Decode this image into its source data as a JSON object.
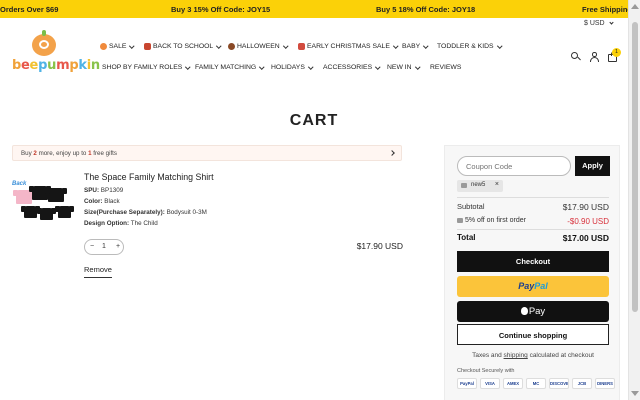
{
  "announcements": [
    {
      "text": "Orders Over $69"
    },
    {
      "text": "Buy 3 15% Off Code: JOY15"
    },
    {
      "text": "Buy 5 18% Off Code: JOY18"
    },
    {
      "text": "Free Shipping On"
    }
  ],
  "header": {
    "currency": "$ USD",
    "logo_text": "beepumpkin",
    "cart_count": "1"
  },
  "nav_row1": [
    {
      "label": "SALE",
      "icon_color": "#f08a3c"
    },
    {
      "label": "BACK TO SCHOOL",
      "icon_color": "#c8452f"
    },
    {
      "label": "HALLOWEEN",
      "icon_color": "#8a4a26"
    },
    {
      "label": "EARLY CHRISTMAS SALE",
      "icon_color": "#d24b3e"
    },
    {
      "label": "BABY"
    },
    {
      "label": "TODDLER & KIDS"
    }
  ],
  "nav_row2": [
    {
      "label": "SHOP BY FAMILY ROLES"
    },
    {
      "label": "FAMILY MATCHING"
    },
    {
      "label": "HOLIDAYS"
    },
    {
      "label": "ACCESSORIES"
    },
    {
      "label": "NEW IN"
    },
    {
      "label": "REVIEWS"
    }
  ],
  "page": {
    "title": "CART"
  },
  "gift": {
    "prefix": "Buy ",
    "count": "2",
    "middle": " more, enjoy up to ",
    "gifts": "1",
    "suffix": " free gifts"
  },
  "product": {
    "image_badge": "Back",
    "title": "The Space Family Matching Shirt",
    "attributes": [
      {
        "label": "SPU:",
        "value": "BP1309"
      },
      {
        "label": "Color:",
        "value": "Black"
      },
      {
        "label": "Size(Purchase Separately):",
        "value": "Bodysuit 0-3M"
      },
      {
        "label": "Design Option:",
        "value": "The Child"
      }
    ],
    "qty_minus": "−",
    "quantity": "1",
    "qty_plus": "+",
    "price": "$17.90 USD",
    "remove_label": "Remove"
  },
  "summary": {
    "coupon_placeholder": "Coupon Code",
    "apply_label": "Apply",
    "applied_code": "new5",
    "remove_code": "×",
    "subtotal_label": "Subtotal",
    "subtotal_value": "$17.90 USD",
    "discount_label": "5% off on first order",
    "discount_value": "-$0.90 USD",
    "discount_color": "#d8323c",
    "total_label": "Total",
    "total_value": "$17.00 USD",
    "checkout_label": "Checkout",
    "paypal_part1": "Pay",
    "paypal_part2": "Pal",
    "apple_pay_label": "Pay",
    "continue_label": "Continue shopping",
    "taxes_prefix": "Taxes and ",
    "taxes_link": "shipping",
    "taxes_suffix": " calculated at checkout",
    "secure_label": "Checkout Securely with",
    "payment_methods": [
      "PayPal",
      "VISA",
      "AMEX",
      "MC",
      "DISCOVER",
      "JCB",
      "DINERS"
    ]
  }
}
